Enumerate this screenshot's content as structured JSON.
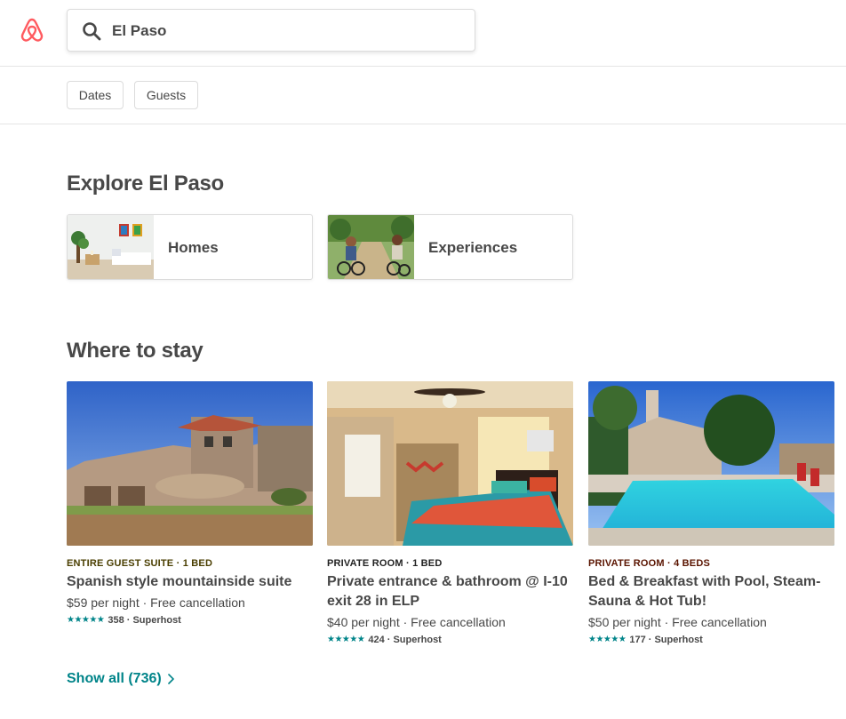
{
  "colors": {
    "brand": "#FF5A5F",
    "accent_teal": "#008489",
    "text": "#484848"
  },
  "header": {
    "logo_icon": "airbnb-logo-icon",
    "search": {
      "icon": "search-icon",
      "value": "El Paso"
    }
  },
  "filters": [
    {
      "label": "Dates"
    },
    {
      "label": "Guests"
    }
  ],
  "explore": {
    "title": "Explore El Paso",
    "categories": [
      {
        "label": "Homes"
      },
      {
        "label": "Experiences"
      }
    ]
  },
  "stay": {
    "title": "Where to stay",
    "listings": [
      {
        "kicker": "ENTIRE GUEST SUITE · 1 BED",
        "kicker_color": "#4a3e00",
        "title": "Spanish style mountainside suite",
        "price": "$59 per night · Free cancellation",
        "stars": "★★★★★",
        "rating": "358 · Superhost"
      },
      {
        "kicker": "PRIVATE ROOM · 1 BED",
        "kicker_color": "#222222",
        "title": "Private entrance & bathroom @ I-10 exit 28 in ELP",
        "price": "$40 per night · Free cancellation",
        "stars": "★★★★★",
        "rating": "424 · Superhost"
      },
      {
        "kicker": "PRIVATE ROOM · 4 BEDS",
        "kicker_color": "#5a1400",
        "title": "Bed & Breakfast with Pool, Steam-Sauna & Hot Tub!",
        "price": "$50 per night · Free cancellation",
        "stars": "★★★★★",
        "rating": "177 · Superhost"
      }
    ],
    "show_all": "Show all (736)"
  }
}
